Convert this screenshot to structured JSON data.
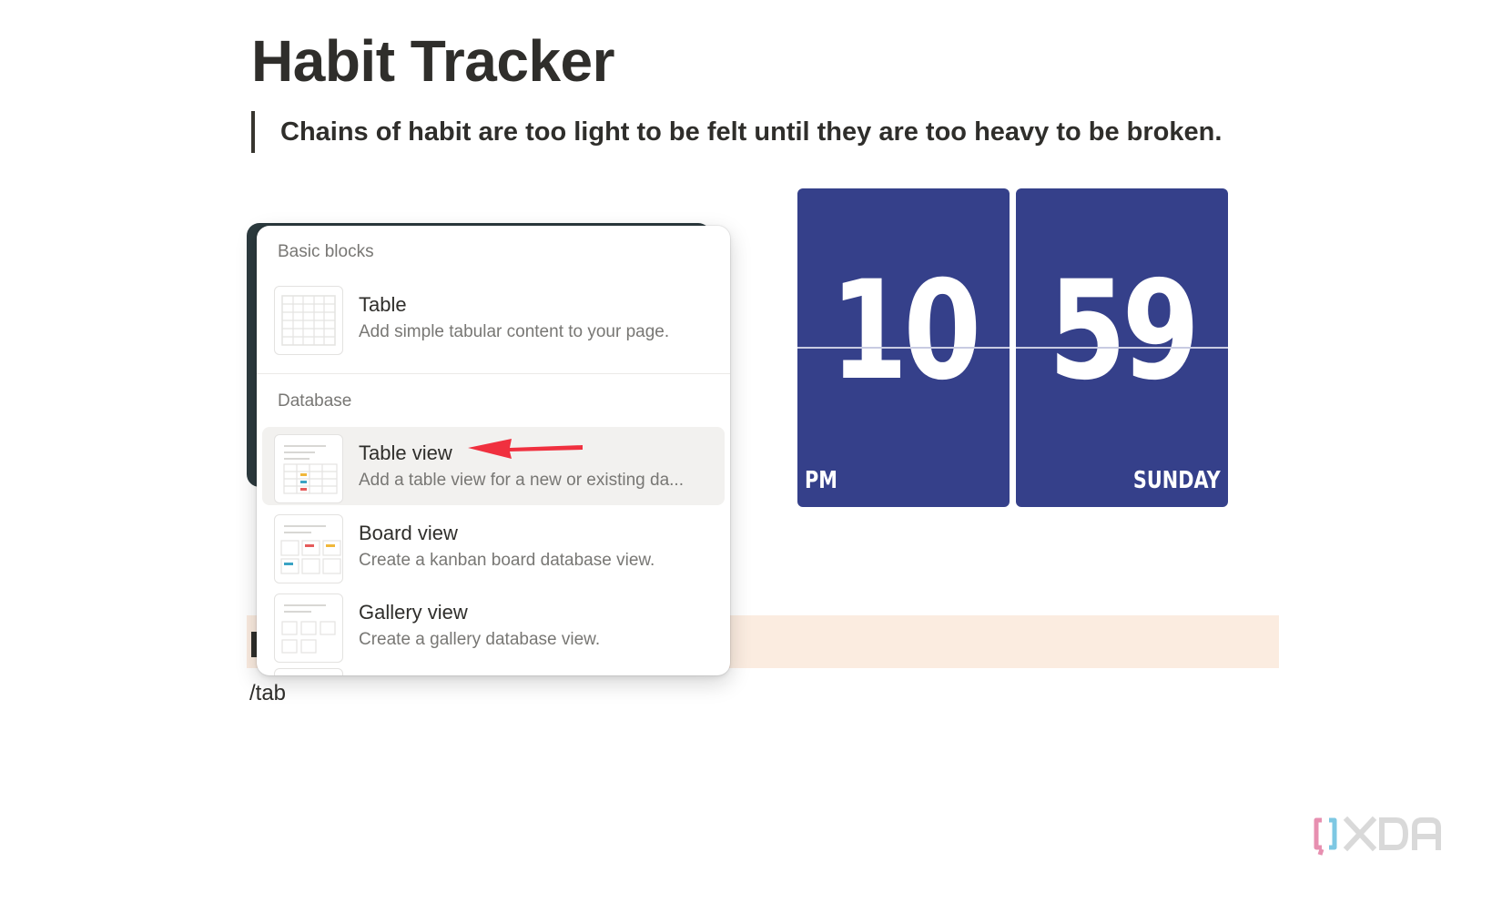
{
  "page": {
    "title": "Habit Tracker",
    "quote": "Chains of habit are too light to be felt until they are too heavy to be broken.",
    "slash_input": "/tab"
  },
  "clock": {
    "hours": "10",
    "minutes": "59",
    "meridiem": "PM",
    "weekday": "SUNDAY",
    "panel_color": "#35408a"
  },
  "menu": {
    "sections": [
      {
        "label": "Basic blocks",
        "items": [
          {
            "title": "Table",
            "description": "Add simple tabular content to your page.",
            "icon": "table-icon"
          }
        ]
      },
      {
        "label": "Database",
        "items": [
          {
            "title": "Table view",
            "description": "Add a table view for a new or existing da...",
            "icon": "table-view-icon",
            "selected": true
          },
          {
            "title": "Board view",
            "description": "Create a kanban board database view.",
            "icon": "board-view-icon"
          },
          {
            "title": "Gallery view",
            "description": "Create a gallery database view.",
            "icon": "gallery-view-icon"
          }
        ]
      }
    ]
  },
  "annotation": {
    "arrow_color": "#f0303f"
  },
  "watermark": {
    "text": "XDA"
  }
}
